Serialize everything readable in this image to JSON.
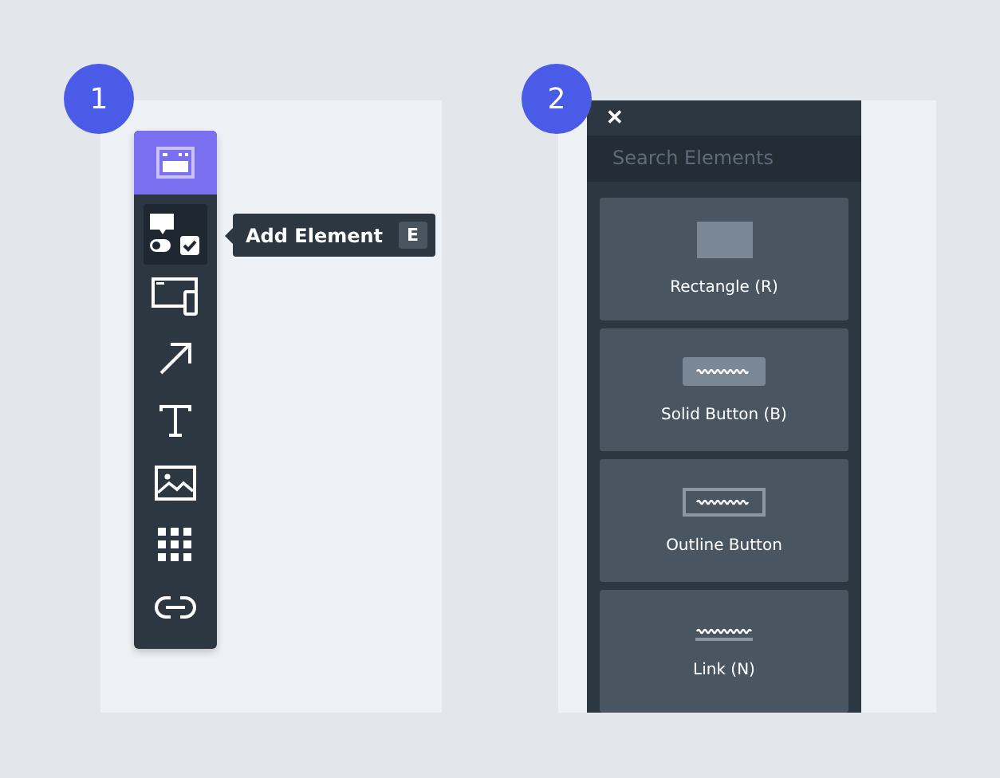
{
  "steps": [
    {
      "number": "1"
    },
    {
      "number": "2"
    }
  ],
  "toolbar": {
    "items": [
      {
        "kind": "window",
        "selected": false
      },
      {
        "kind": "add-element",
        "selected": true
      },
      {
        "kind": "devices",
        "selected": false
      },
      {
        "kind": "arrow",
        "selected": false
      },
      {
        "kind": "text",
        "selected": false
      },
      {
        "kind": "image",
        "selected": false
      },
      {
        "kind": "grid",
        "selected": false
      },
      {
        "kind": "link",
        "selected": false
      }
    ]
  },
  "tooltip": {
    "label": "Add Element",
    "shortcut": "E"
  },
  "elements_panel": {
    "close": "✕",
    "search": {
      "placeholder": "Search Elements"
    },
    "cards": [
      {
        "kind": "rectangle",
        "label": "Rectangle (R)"
      },
      {
        "kind": "solid-button",
        "label": "Solid Button (B)"
      },
      {
        "kind": "outline-button",
        "label": "Outline Button"
      },
      {
        "kind": "link",
        "label": "Link (N)"
      }
    ]
  }
}
